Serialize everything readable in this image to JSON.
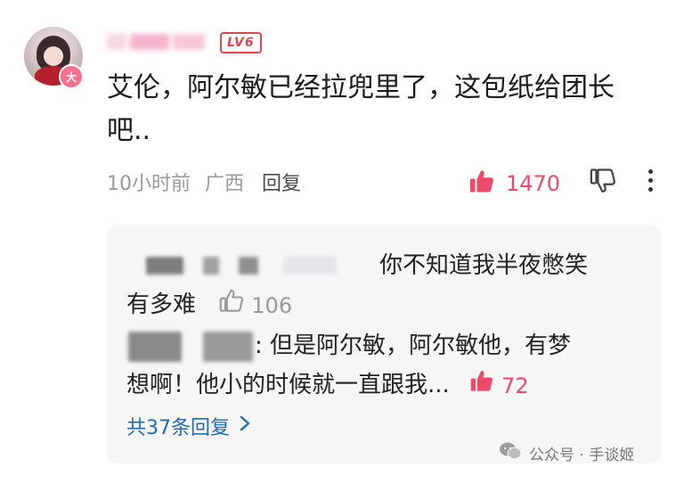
{
  "comment": {
    "level_badge": "LV6",
    "avatar_badge": "大",
    "text_line1": "艾伦，阿尔敏已经拉兜里了，这包纸给团长",
    "text_line2": "吧..",
    "time": "10小时前",
    "location": "广西",
    "reply_label": "回复",
    "like_count": "1470",
    "accent_color": "#ec4a69",
    "icons": [
      "thumbs-up-icon",
      "thumbs-down-icon",
      "more-vertical-icon"
    ]
  },
  "replies": {
    "items": [
      {
        "text_line1": "你不知道我半夜憋笑",
        "text_line2": "有多难",
        "like_count": "106",
        "liked": false
      },
      {
        "text_line1": ": 但是阿尔敏，阿尔敏他，有梦",
        "text_line2": "想啊！他小的时候就一直跟我...",
        "like_count": "72",
        "liked": true
      }
    ],
    "see_all_label": "共37条回复",
    "link_color": "#1f6bb5"
  },
  "watermark": {
    "text": "公众号 · 手谈姬"
  }
}
